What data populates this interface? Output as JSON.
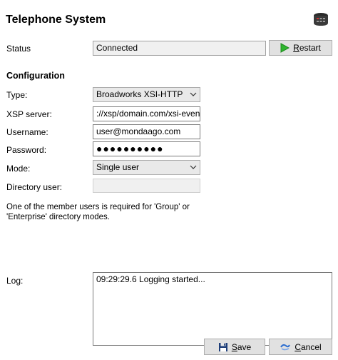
{
  "window": {
    "title": "Telephone System"
  },
  "status": {
    "label": "Status",
    "value": "Connected",
    "restart_label": "Restart",
    "restart_mnemonic": "R",
    "restart_rest": "estart"
  },
  "configuration": {
    "heading": "Configuration",
    "type": {
      "label": "Type:",
      "value": "Broadworks XSI-HTTP"
    },
    "xsp_server": {
      "label": "XSP server:",
      "value": "://xsp/domain.com/xsi-events"
    },
    "username": {
      "label": "Username:",
      "value": "user@mondaago.com"
    },
    "password": {
      "label": "Password:",
      "value": "●●●●●●●●●●"
    },
    "mode": {
      "label": "Mode:",
      "value": "Single user"
    },
    "directory_user": {
      "label": "Directory user:",
      "value": ""
    },
    "note": "One of the member users is required for 'Group' or 'Enterprise' directory modes."
  },
  "log": {
    "label": "Log:",
    "entries": [
      "09:29:29.6  Logging started..."
    ]
  },
  "footer": {
    "save_mnemonic": "S",
    "save_rest": "ave",
    "cancel_mnemonic": "C",
    "cancel_rest": "ancel"
  },
  "colors": {
    "restart_icon": "#2fb52f",
    "save_icon": "#1f3f7a",
    "cancel_icon": "#2f6fd0"
  },
  "icons": {
    "window": "telephone-icon",
    "restart": "play-icon",
    "save": "floppy-disk-icon",
    "cancel": "cancel-icon"
  }
}
